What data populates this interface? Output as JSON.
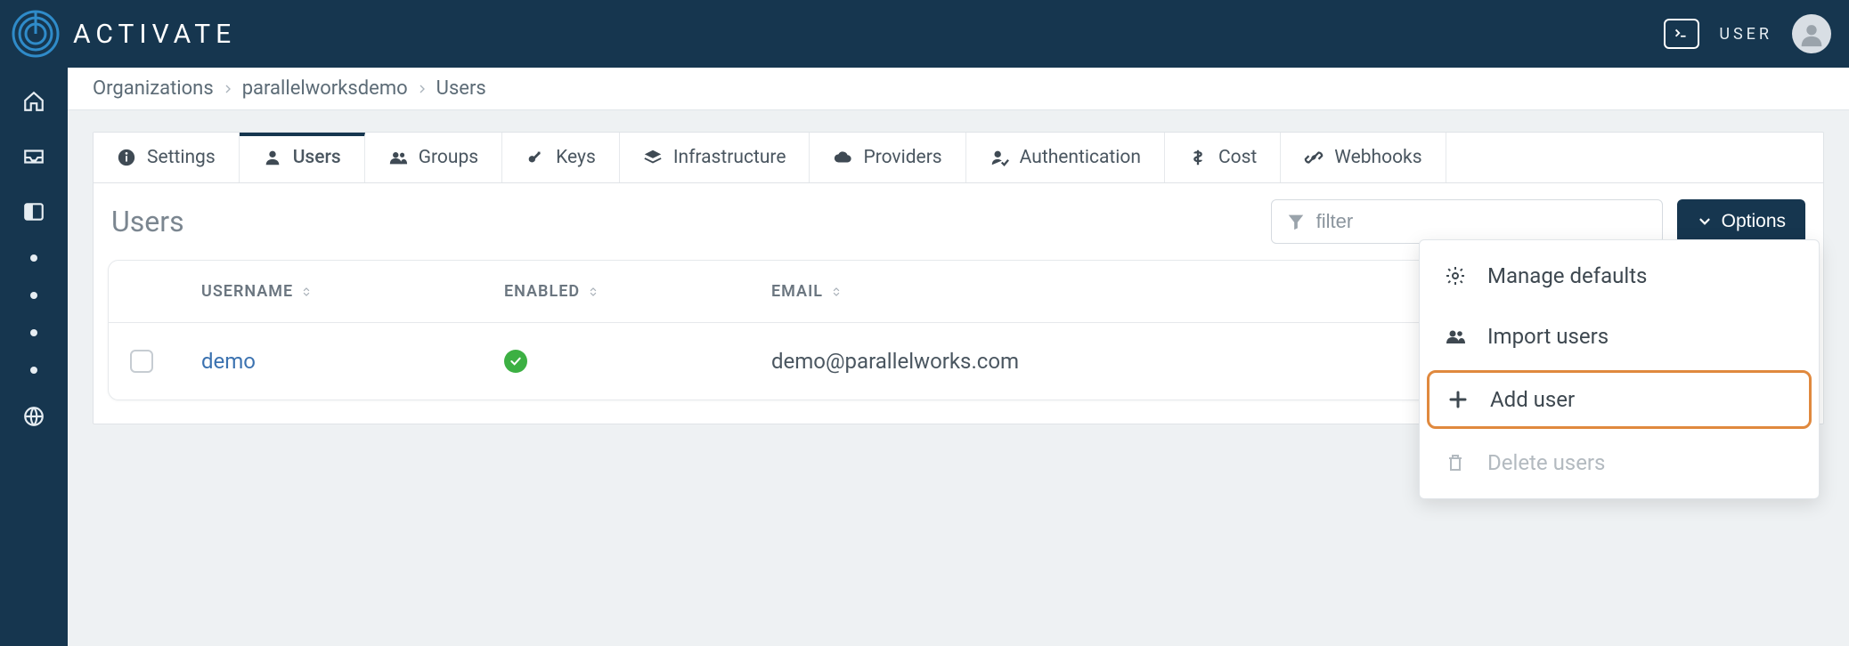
{
  "brand": {
    "name": "ACTIVATE"
  },
  "user_menu": {
    "label": "USER"
  },
  "breadcrumbs": [
    "Organizations",
    "parallelworksdemo",
    "Users"
  ],
  "tabs": [
    {
      "id": "settings",
      "label": "Settings",
      "icon": "info"
    },
    {
      "id": "users",
      "label": "Users",
      "icon": "user",
      "active": true
    },
    {
      "id": "groups",
      "label": "Groups",
      "icon": "users"
    },
    {
      "id": "keys",
      "label": "Keys",
      "icon": "key"
    },
    {
      "id": "infrastructure",
      "label": "Infrastructure",
      "icon": "layers"
    },
    {
      "id": "providers",
      "label": "Providers",
      "icon": "cloud"
    },
    {
      "id": "authentication",
      "label": "Authentication",
      "icon": "user-check"
    },
    {
      "id": "cost",
      "label": "Cost",
      "icon": "dollar"
    },
    {
      "id": "webhooks",
      "label": "Webhooks",
      "icon": "link"
    }
  ],
  "panel": {
    "title": "Users",
    "filter_placeholder": "filter",
    "options_label": "Options"
  },
  "table": {
    "columns": [
      "USERNAME",
      "ENABLED",
      "EMAIL"
    ],
    "rows": [
      {
        "username": "demo",
        "enabled": true,
        "email": "demo@parallelworks.com"
      }
    ]
  },
  "options_menu": {
    "items": [
      {
        "id": "manage-defaults",
        "label": "Manage defaults",
        "icon": "gear"
      },
      {
        "id": "import-users",
        "label": "Import users",
        "icon": "users"
      },
      {
        "id": "add-user",
        "label": "Add user",
        "icon": "plus",
        "highlight": true
      },
      {
        "id": "delete-users",
        "label": "Delete users",
        "icon": "trash",
        "disabled": true
      }
    ]
  }
}
